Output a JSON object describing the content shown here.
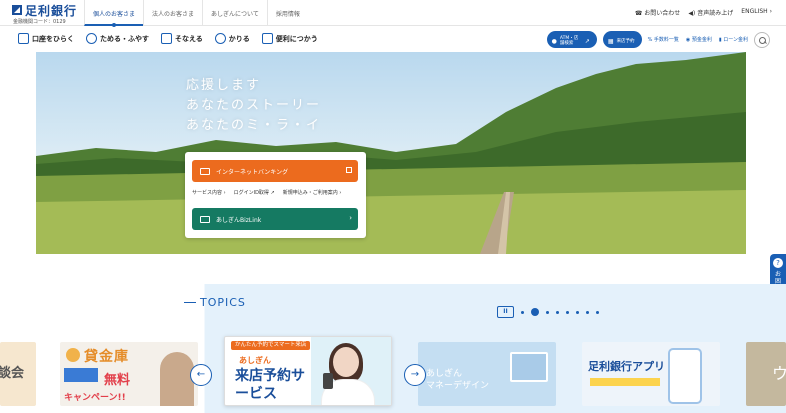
{
  "header": {
    "logo_name": "足利銀行",
    "bank_code": "金融機関コード：0129",
    "segment_tabs": [
      "個人のお客さま",
      "法人のお客さま",
      "あしぎんについて",
      "採用情報"
    ],
    "contact": "お問い合わせ",
    "read_aloud": "音声読み上げ",
    "english": "ENGLISH"
  },
  "nav": {
    "menu": [
      "口座をひらく",
      "ためる・ふやす",
      "そなえる",
      "かりる",
      "便利につかう"
    ],
    "atm_pill": "ATM・店舗検索",
    "visit_pill": "来店予約",
    "links": [
      "手数料一覧",
      "預金金利",
      "ローン金利"
    ]
  },
  "hero": {
    "copy_lines": [
      "応援します",
      "あなたのストーリー",
      "あなたのミ・ラ・イ"
    ],
    "internet_banking": "インターネットバンキング",
    "sublinks": [
      "サービス内容",
      "ログインID取得",
      "新規申込み・ご利用案内"
    ],
    "bizlink": "あしぎんBizLink"
  },
  "sidetab": {
    "label": "お困りの場合はこちら"
  },
  "topics": {
    "title": "TOPICS",
    "pause": "II",
    "slides": {
      "partial_left": "談会",
      "loan_title": "貸金庫",
      "loan_free": "無料",
      "loan_campaign": "キャンペーン!!",
      "visit_tag": "かんたん予約でスマート来店",
      "visit_sub": "あしぎん",
      "visit_title": "来店予約サービス",
      "money_line1": "あしぎん",
      "money_line2": "マネーデザイン",
      "app_title": "足利銀行アプリ",
      "partial_right": "ウ"
    }
  }
}
